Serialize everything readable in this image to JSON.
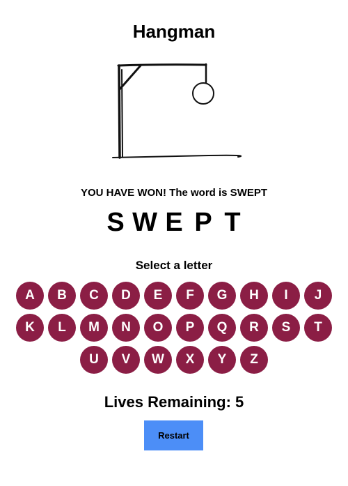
{
  "game": {
    "title": "Hangman",
    "message": "YOU HAVE WON! The word is SWEPT",
    "word_letters": [
      "S",
      "W",
      "E",
      "P",
      "T"
    ],
    "select_label": "Select a letter",
    "keyboard_rows": [
      [
        "A",
        "B",
        "C",
        "D",
        "E",
        "F",
        "G",
        "H",
        "I",
        "J"
      ],
      [
        "K",
        "L",
        "M",
        "N",
        "O",
        "P",
        "Q",
        "R",
        "S",
        "T"
      ],
      [
        "U",
        "V",
        "W",
        "X",
        "Y",
        "Z"
      ]
    ],
    "lives_label": "Lives Remaining: 5",
    "restart_label": "Restart"
  },
  "colors": {
    "key_background": "#8b1e45",
    "key_text": "#ffffff",
    "restart_background": "#4c8ef7"
  }
}
